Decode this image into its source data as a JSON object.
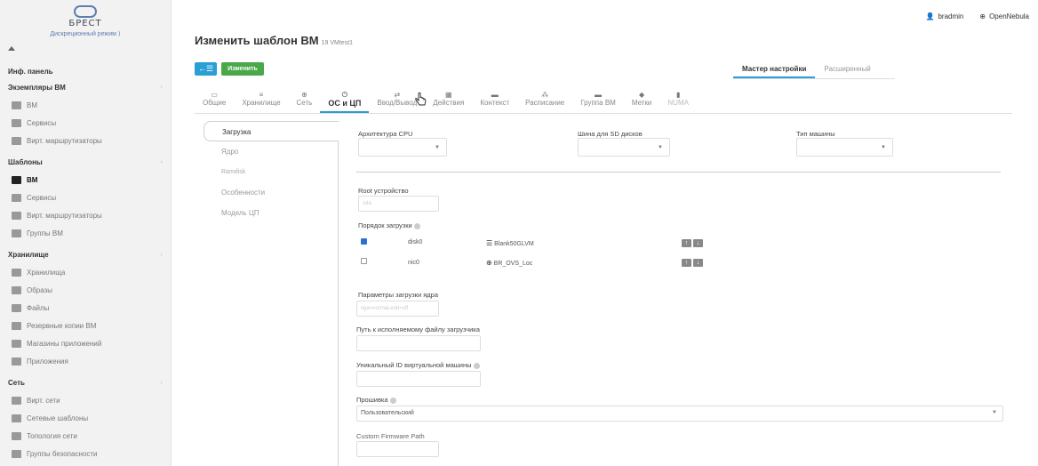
{
  "brand": {
    "logo": "БРЕСТ",
    "mode": "Дискреционный режим"
  },
  "user": {
    "name": "bradmin",
    "zone": "OpenNebula"
  },
  "sidebar": {
    "dashboard": "Инф. панель",
    "sections": [
      {
        "title": "Экземпляры ВМ",
        "items": [
          {
            "label": "ВМ",
            "icon": "grid-icon"
          },
          {
            "label": "Сервисы",
            "icon": "services-icon"
          },
          {
            "label": "Вирт. маршрутизаторы",
            "icon": "router-icon"
          }
        ]
      },
      {
        "title": "Шаблоны",
        "items": [
          {
            "label": "ВМ",
            "icon": "file-icon",
            "active": true
          },
          {
            "label": "Сервисы",
            "icon": "copy-icon"
          },
          {
            "label": "Вирт. маршрутизаторы",
            "icon": "router-icon"
          },
          {
            "label": "Группы ВМ",
            "icon": "folder-icon"
          }
        ]
      },
      {
        "title": "Хранилище",
        "items": [
          {
            "label": "Хранилища",
            "icon": "folder-icon"
          },
          {
            "label": "Образы",
            "icon": "download-icon"
          },
          {
            "label": "Файлы",
            "icon": "files-icon"
          },
          {
            "label": "Резервные копии ВМ",
            "icon": "backup-icon"
          },
          {
            "label": "Магазины приложений",
            "icon": "cart-icon"
          },
          {
            "label": "Приложения",
            "icon": "cloud-icon"
          }
        ]
      },
      {
        "title": "Сеть",
        "items": [
          {
            "label": "Вирт. сети",
            "icon": "network-icon"
          },
          {
            "label": "Сетевые шаблоны",
            "icon": "copy-icon"
          },
          {
            "label": "Топология сети",
            "icon": "topology-icon"
          },
          {
            "label": "Группы безопасности",
            "icon": "shield-icon"
          }
        ]
      }
    ]
  },
  "header": {
    "title": "Изменить шаблон ВМ",
    "subtitle": "19 VMtest1"
  },
  "toolbar": {
    "back": "←☰",
    "update": "Изменить"
  },
  "mode_tabs": {
    "wizard": "Мастер настройки",
    "advanced": "Расширенный"
  },
  "tabs": [
    {
      "label": "Общие",
      "glyph": "▭"
    },
    {
      "label": "Хранилище",
      "glyph": "≡"
    },
    {
      "label": "Сеть",
      "glyph": "⊕"
    },
    {
      "label": "ОС и ЦП",
      "glyph": "⏻",
      "active": true
    },
    {
      "label": "Ввод/Вывод",
      "glyph": "⇄"
    },
    {
      "label": "Действия",
      "glyph": "▦"
    },
    {
      "label": "Контекст",
      "glyph": "▬"
    },
    {
      "label": "Расписание",
      "glyph": "⁂"
    },
    {
      "label": "Группа ВМ",
      "glyph": "▬"
    },
    {
      "label": "Метки",
      "glyph": "◆"
    },
    {
      "label": "NUMA",
      "glyph": "▮",
      "disabled": true
    }
  ],
  "vtabs": [
    "Загрузка",
    "Ядро",
    "Ramdisk",
    "Особенности",
    "Модель ЦП"
  ],
  "form": {
    "arch_label": "Архитектура CPU",
    "bus_label": "Шина для SD дисков",
    "machine_label": "Тип машины",
    "root_label": "Root устройство",
    "root_placeholder": "sda",
    "boot_label": "Порядок загрузки",
    "boot": [
      {
        "name": "disk0",
        "target": "Blank50GLVM",
        "checked": true
      },
      {
        "name": "nic0",
        "target": "BR_OVS_Loc",
        "checked": false
      }
    ],
    "kernel_params_label": "Параметры загрузки ядра",
    "kernel_params_placeholder": "vga=normal,edd=off",
    "bootloader_label": "Путь к исполняемому файлу загрузчика",
    "uuid_label": "Уникальный ID виртуальной машины",
    "firmware_label": "Прошивка",
    "firmware_value": "Пользовательский",
    "custom_fw_label": "Custom Firmware Path"
  }
}
